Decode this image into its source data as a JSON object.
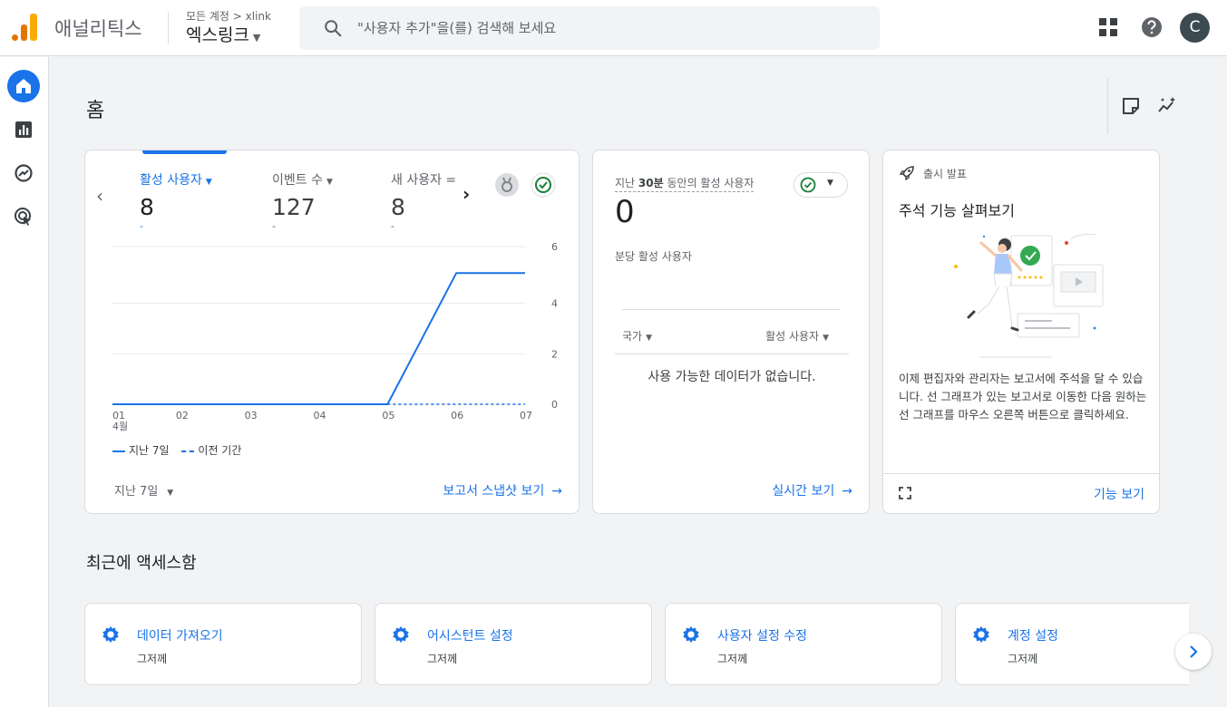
{
  "header": {
    "app_title": "애널리틱스",
    "account_breadcrumb": "모든 계정 > xlink",
    "account_name": "엑스링크",
    "search_placeholder": "\"사용자 추가\"을(를) 검색해 보세요",
    "avatar_letter": "C"
  },
  "page": {
    "title": "홈"
  },
  "overview_card": {
    "metrics": [
      {
        "label": "활성 사용자",
        "value": "8",
        "compare": "-"
      },
      {
        "label": "이벤트 수",
        "value": "127",
        "compare": "-"
      },
      {
        "label": "새 사용자 =",
        "value": "8",
        "compare": "-"
      }
    ],
    "legend": {
      "current": "지난 7일",
      "previous": "이전 기간"
    },
    "period_select": "지난 7일",
    "link": "보고서 스냅샷 보기"
  },
  "chart_data": {
    "type": "line",
    "x": [
      "01",
      "02",
      "03",
      "04",
      "05",
      "06",
      "07"
    ],
    "x_sub_label": "4월",
    "series": [
      {
        "name": "지난 7일",
        "values": [
          0,
          0,
          0,
          0,
          0,
          5.2,
          5.2
        ]
      },
      {
        "name": "이전 기간",
        "values": [
          0,
          0,
          0,
          0,
          0,
          0,
          0
        ]
      }
    ],
    "ylim": [
      0,
      6
    ],
    "yticks": [
      "0",
      "2",
      "4",
      "6"
    ],
    "grid": true,
    "legend": "bottom-left"
  },
  "realtime_card": {
    "label_prefix": "지난",
    "label_bold": "30분",
    "label_suffix": "동안의 활성 사용자",
    "value": "0",
    "subtitle": "분당 활성 사용자",
    "col_country": "국가",
    "col_users": "활성 사용자",
    "empty": "사용 가능한 데이터가 없습니다.",
    "link": "실시간 보기"
  },
  "release_card": {
    "header": "출시 발표",
    "title": "주석 기능 살펴보기",
    "description": "이제 편집자와 관리자는 보고서에 주석을 달 수 있습니다. 선 그래프가 있는 보고서로 이동한 다음 원하는 선 그래프를 마우스 오른쪽 버튼으로 클릭하세요.",
    "link": "기능 보기"
  },
  "recent": {
    "title": "최근에 액세스함",
    "items": [
      {
        "title": "데이터 가져오기",
        "subtitle": "그저께"
      },
      {
        "title": "어시스턴트 설정",
        "subtitle": "그저께"
      },
      {
        "title": "사용자 설정 수정",
        "subtitle": "그저께"
      },
      {
        "title": "계정 설정",
        "subtitle": "그저께"
      }
    ]
  },
  "colors": {
    "accent": "#1a73e8",
    "logo_orange": "#e37400",
    "logo_yellow": "#f9ab00",
    "success": "#188038"
  }
}
